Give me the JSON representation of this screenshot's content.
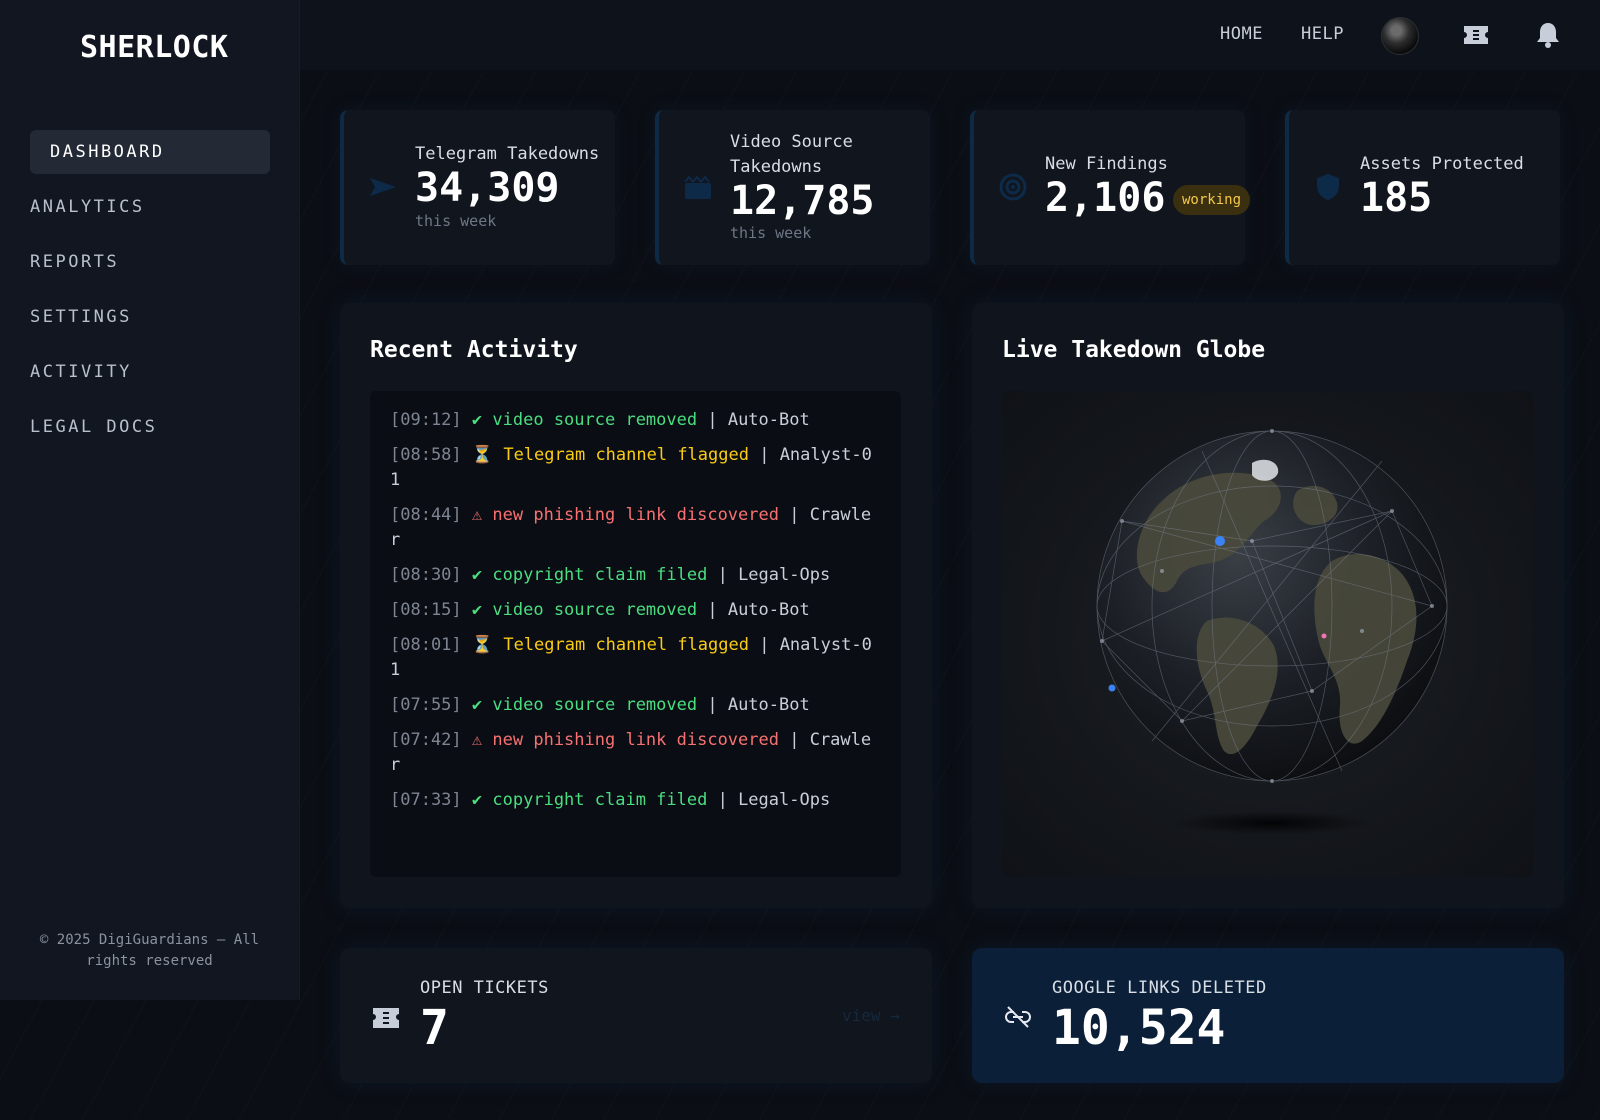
{
  "brand": "SHERLOCK",
  "sidebar": {
    "items": [
      {
        "label": "DASHBOARD"
      },
      {
        "label": "ANALYTICS"
      },
      {
        "label": "REPORTS"
      },
      {
        "label": "SETTINGS"
      },
      {
        "label": "ACTIVITY"
      },
      {
        "label": "LEGAL DOCS"
      }
    ],
    "active": "DASHBOARD",
    "copyright_line1": "© 2025 DigiGuardians — All",
    "copyright_line2": "rights reserved"
  },
  "header": {
    "links": [
      {
        "label": "HOME"
      },
      {
        "label": "HELP"
      }
    ],
    "icons": [
      "avatar",
      "ticket-icon",
      "bell-icon"
    ]
  },
  "stats": [
    {
      "label_lines": [
        "Telegram Takedowns"
      ],
      "value": "34,309",
      "sub": "this week",
      "icon": "send-icon"
    },
    {
      "label_lines": [
        "Video Source",
        "Takedowns"
      ],
      "value": "12,785",
      "sub": "this week",
      "icon": "video-icon"
    },
    {
      "label_lines": [
        "New Findings"
      ],
      "value": "2,106",
      "badge": "working",
      "icon": "target-icon"
    },
    {
      "label_lines": [
        "Assets Protected"
      ],
      "value": "185",
      "icon": "shield-icon"
    }
  ],
  "activity": {
    "title": "Recent Activity",
    "entries": [
      {
        "time": "[09:12]",
        "symbol": "✔",
        "message": "video source removed",
        "actor": "Auto-Bot",
        "level": "success"
      },
      {
        "time": "[08:58]",
        "symbol": "⏳",
        "message": "Telegram channel flagged",
        "actor": "Analyst-01",
        "level": "warning"
      },
      {
        "time": "[08:44]",
        "symbol": "⚠",
        "message": "new phishing link discovered",
        "actor": "Crawler",
        "level": "danger"
      },
      {
        "time": "[08:30]",
        "symbol": "✔",
        "message": "copyright claim filed",
        "actor": "Legal-Ops",
        "level": "success"
      },
      {
        "time": "[08:15]",
        "symbol": "✔",
        "message": "video source removed",
        "actor": "Auto-Bot",
        "level": "success"
      },
      {
        "time": "[08:01]",
        "symbol": "⏳",
        "message": "Telegram channel flagged",
        "actor": "Analyst-01",
        "level": "warning"
      },
      {
        "time": "[07:55]",
        "symbol": "✔",
        "message": "video source removed",
        "actor": "Auto-Bot",
        "level": "success"
      },
      {
        "time": "[07:42]",
        "symbol": "⚠",
        "message": "new phishing link discovered",
        "actor": "Crawler",
        "level": "danger"
      },
      {
        "time": "[07:33]",
        "symbol": "✔",
        "message": "copyright claim filed",
        "actor": "Legal-Ops",
        "level": "success"
      }
    ]
  },
  "globe": {
    "title": "Live Takedown Globe",
    "marker_colors": [
      "#3b82f6",
      "#f472b6"
    ]
  },
  "bottom": {
    "tickets": {
      "label": "OPEN TICKETS",
      "value": "7",
      "link": "view →",
      "icon": "ticket-icon"
    },
    "google": {
      "label": "GOOGLE LINKS DELETED",
      "value": "10,524",
      "icon": "unlink-icon"
    }
  },
  "colors": {
    "background": "#0b0e14",
    "sidebar": "#111620",
    "card": "#10151e",
    "accent_blue": "#0d2640",
    "success": "#4ade80",
    "warning": "#facc15",
    "danger": "#f87171"
  }
}
